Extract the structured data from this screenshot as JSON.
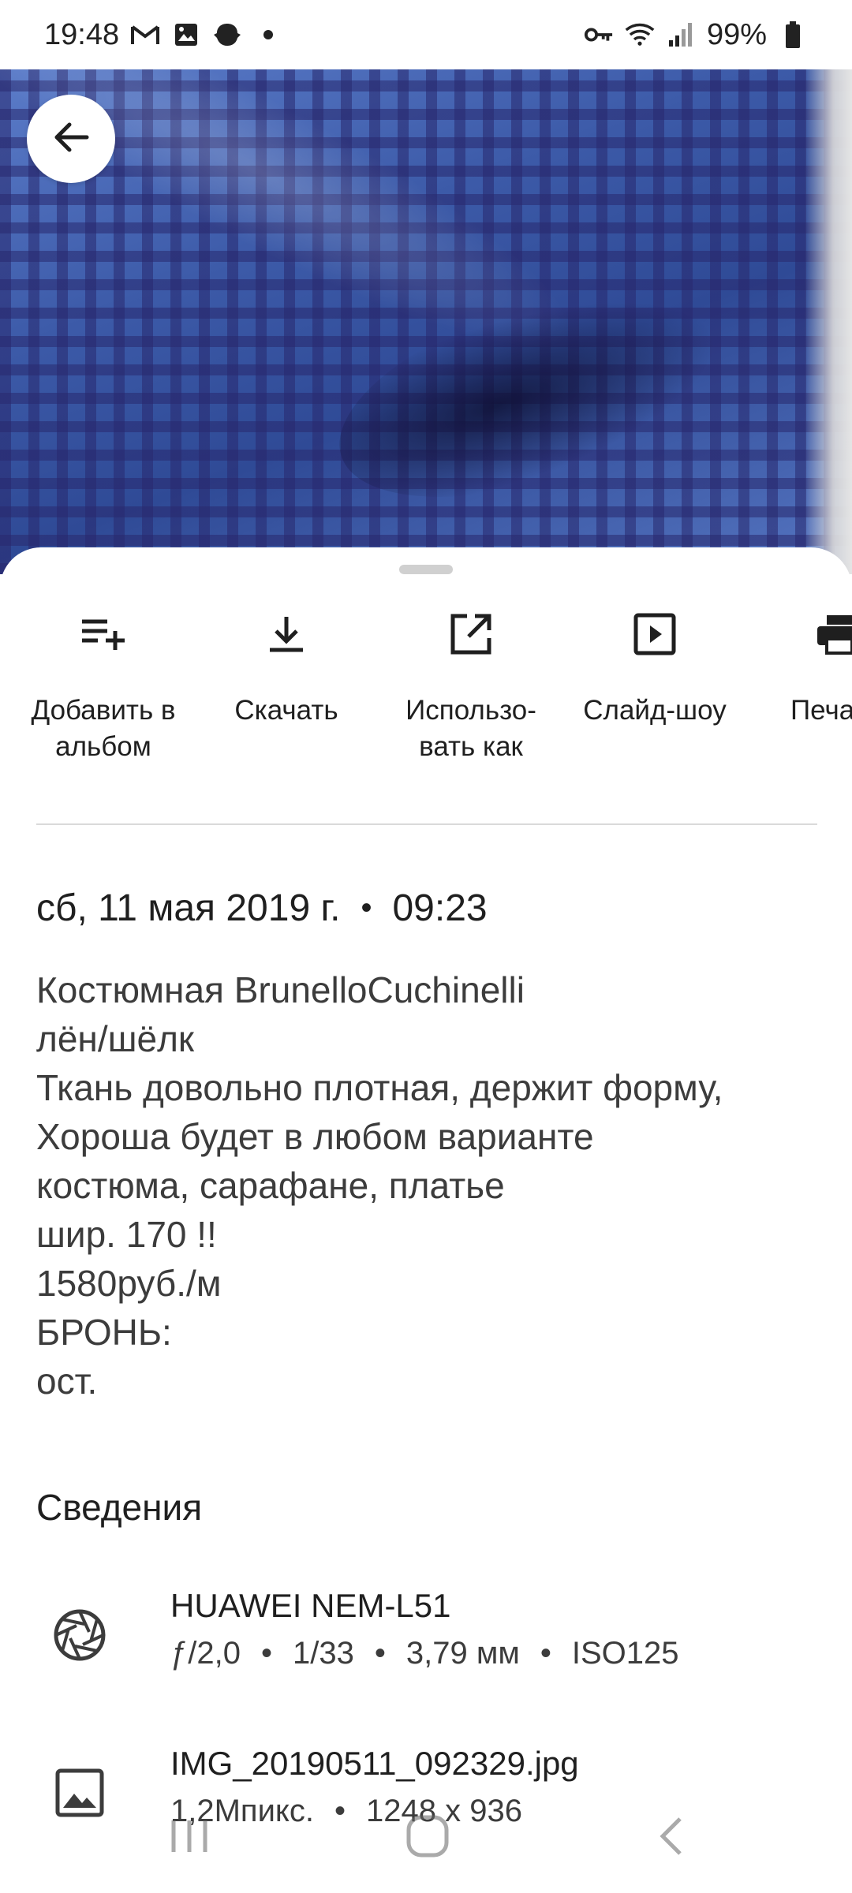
{
  "status_bar": {
    "time": "19:48",
    "left_icons": [
      "gmail-icon",
      "gallery-icon",
      "app-icon",
      "dot-icon"
    ],
    "right_icons": [
      "vpn-key-icon",
      "wifi-icon",
      "signal-icon"
    ],
    "battery": "99%"
  },
  "header": {
    "back_icon": "arrow-left-icon"
  },
  "actions": [
    {
      "icon": "playlist-add-icon",
      "label_line1": "Добавить в",
      "label_line2": "альбом"
    },
    {
      "icon": "download-icon",
      "label_line1": "Скачать",
      "label_line2": ""
    },
    {
      "icon": "open-in-new-icon",
      "label_line1": "Использо-",
      "label_line2": "вать как"
    },
    {
      "icon": "slideshow-icon",
      "label_line1": "Слайд-шоу",
      "label_line2": ""
    },
    {
      "icon": "print-icon",
      "label_line1": "Печа",
      "label_line2": ""
    }
  ],
  "date": {
    "date": "сб, 11 мая 2019 г.",
    "separator": "•",
    "time": "09:23"
  },
  "description": [
    "Костюмная BrunelloCuchinelli",
    "лён/шёлк",
    "Ткань довольно плотная, держит форму,",
    "Хороша будет в любом варианте",
    "костюма, сарафане, платье",
    "шир. 170 !!",
    "1580руб./м",
    "БРОНЬ:",
    "ост."
  ],
  "details": {
    "title": "Сведения",
    "camera": {
      "icon": "camera-aperture-icon",
      "model": "HUAWEI NEM-L51",
      "aperture": "ƒ/2,0",
      "shutter": "1/33",
      "focal": "3,79 мм",
      "iso": "ISO125",
      "sep": "•"
    },
    "file": {
      "icon": "image-icon",
      "name": "IMG_20190511_092329.jpg",
      "megapixels": "1,2Мпикс.",
      "resolution": "1248 x 936",
      "sep": "•"
    }
  },
  "nav": {
    "icons": [
      "recent-apps-icon",
      "home-icon",
      "back-icon"
    ]
  }
}
